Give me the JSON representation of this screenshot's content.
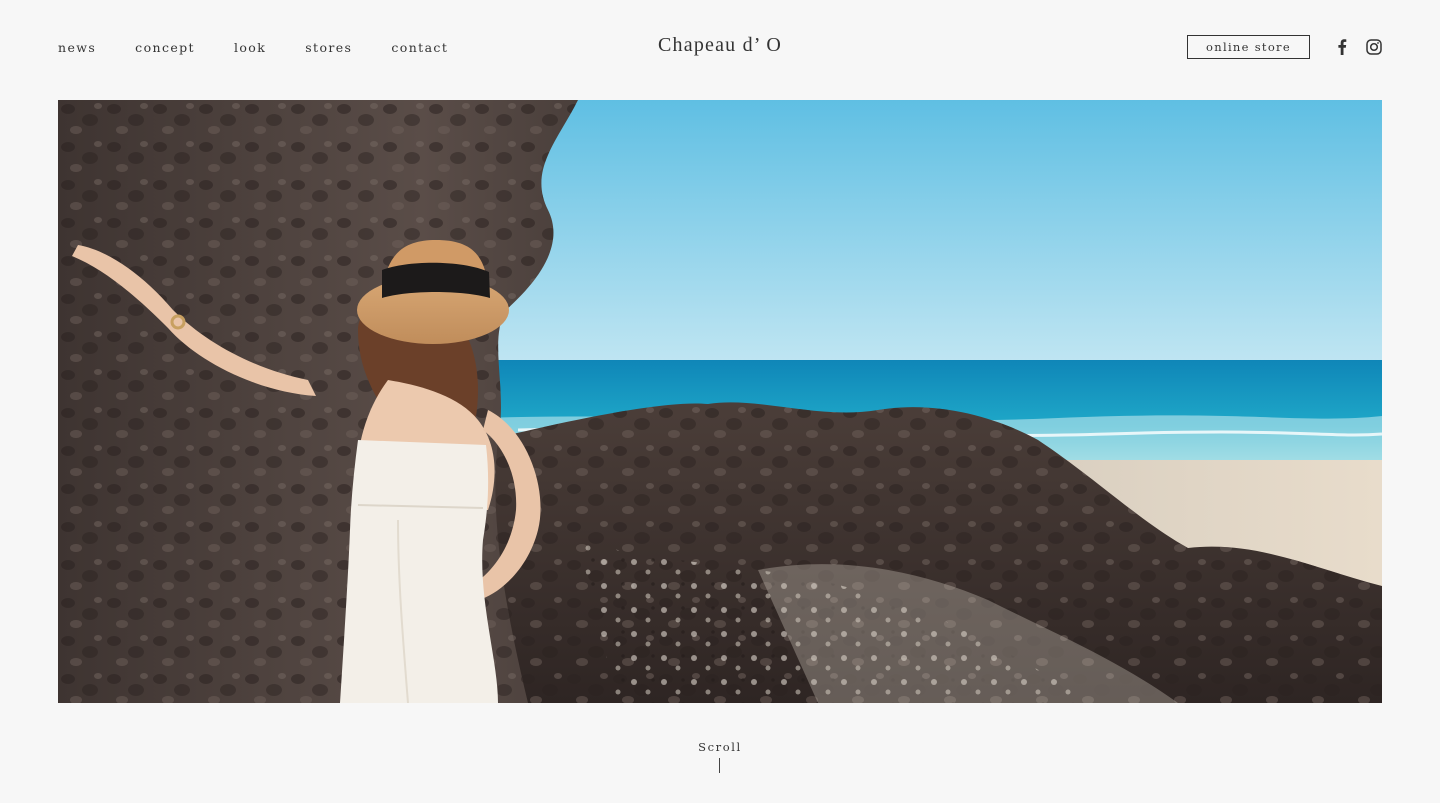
{
  "nav": {
    "items": [
      {
        "label": "news"
      },
      {
        "label": "concept"
      },
      {
        "label": "look"
      },
      {
        "label": "stores"
      },
      {
        "label": "contact"
      }
    ]
  },
  "brand": {
    "logo": "Chapeau d’ O"
  },
  "header_actions": {
    "online_store_label": "online store",
    "social": [
      {
        "icon": "facebook-icon"
      },
      {
        "icon": "instagram-icon"
      }
    ]
  },
  "hero": {
    "image_subject": "woman-in-straw-hat-on-rocky-beach"
  },
  "scroll": {
    "label": "Scroll"
  },
  "colors": {
    "background": "#f7f7f7",
    "text": "#333333"
  }
}
